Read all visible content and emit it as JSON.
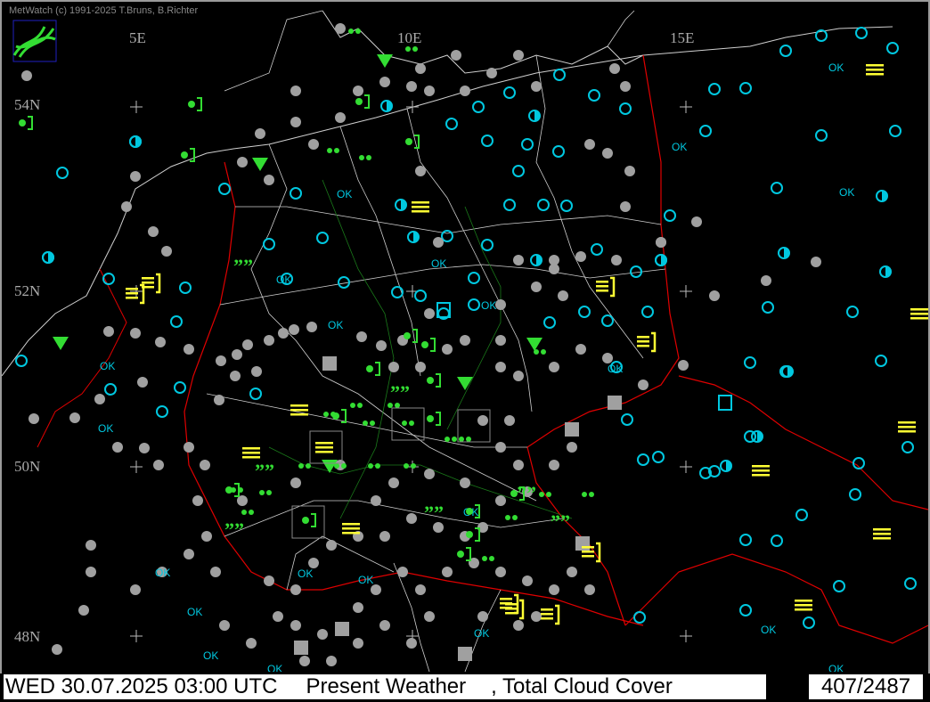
{
  "app": {
    "credit": "MetWatch  (c) 1991-2025 T.Bruns, B.Richter"
  },
  "map": {
    "longitude_labels": [
      "5E",
      "10E",
      "15E"
    ],
    "latitude_labels": [
      "54N",
      "52N",
      "50N",
      "48N"
    ],
    "colors": {
      "background": "#000000",
      "borders": "#e00000",
      "regions": "#cfcfcf",
      "rivers": "#1a7a1a",
      "clear_sky": "#00c8e0",
      "overcast": "#a0a0a0",
      "rain": "#33dd33",
      "fog": "#ffff33"
    },
    "legend_symbols": [
      "cloud-cover-circle",
      "ok-station",
      "rain-dots",
      "drizzle-commas",
      "fog-bars",
      "thunder-bracket"
    ]
  },
  "status": {
    "date_time": "WED 30.07.2025 03:00 UTC",
    "parameter": "Present Weather",
    "parameter2": ", Total Cloud Cover",
    "count": "407/2487"
  }
}
